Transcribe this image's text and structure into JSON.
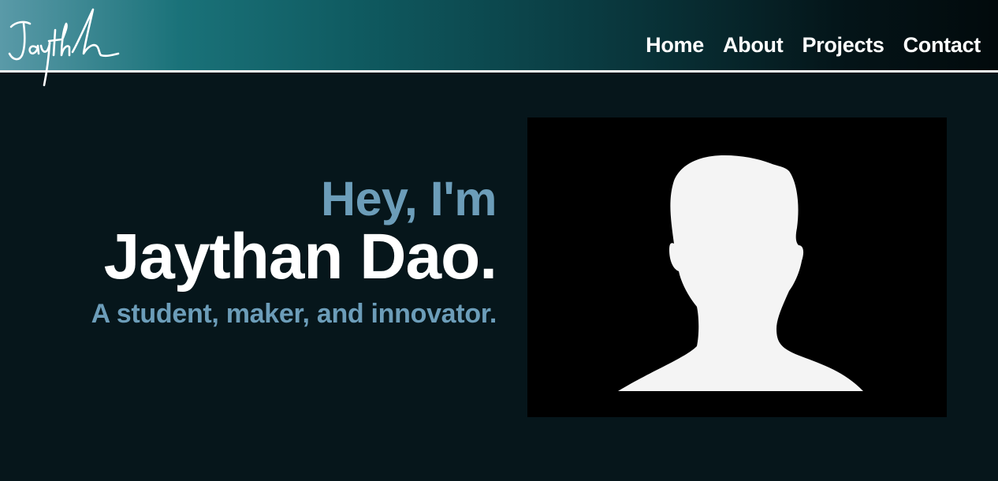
{
  "header": {
    "logo_icon": "signature-logo-icon",
    "nav": [
      {
        "label": "Home"
      },
      {
        "label": "About"
      },
      {
        "label": "Projects"
      },
      {
        "label": "Contact"
      }
    ]
  },
  "hero": {
    "greeting": "Hey, I'm",
    "name": "Jaythan Dao.",
    "tagline": "A student, maker, and innovator.",
    "photo_icon": "profile-silhouette-icon"
  },
  "colors": {
    "background": "#06161b",
    "accent": "#6c9db9",
    "nav_gradient_start": "#5a9aa8",
    "nav_gradient_end": "#020a0c",
    "text": "#ffffff"
  }
}
